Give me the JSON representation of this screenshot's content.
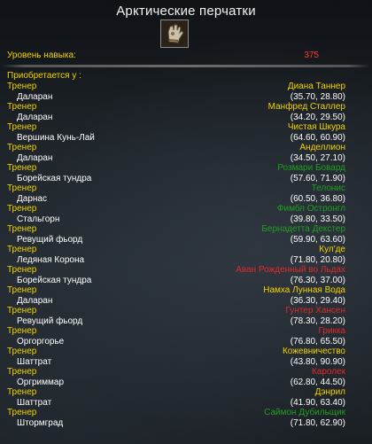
{
  "tooltip": {
    "title": "Арктические перчатки",
    "icon": "gloves-icon",
    "skill_label": "Уровень навыка:",
    "skill_value": "375",
    "acquired_label": "Приобретается у :"
  },
  "colors": {
    "label_yellow": "#f3d400",
    "value_red": "#ff3b30",
    "neutral": "#f3d400",
    "alliance": "#1fa01f",
    "horde": "#e02a2a",
    "white": "#ffffff"
  },
  "entries": [
    {
      "type": "Тренер",
      "npc": "Диана Таннер",
      "zone": "Даларан",
      "coords": "(35.70, 28.80)",
      "color": "#f3d400"
    },
    {
      "type": "Тренер",
      "npc": "Манфред Сталлер",
      "zone": "Даларан",
      "coords": "(34.20, 29.50)",
      "color": "#f3d400"
    },
    {
      "type": "Тренер",
      "npc": "Чистая Шкура",
      "zone": "Вершина Кунь-Лай",
      "coords": "(64.60, 60.90)",
      "color": "#f3d400"
    },
    {
      "type": "Тренер",
      "npc": "Анделлион",
      "zone": "Даларан",
      "coords": "(34.50, 27.10)",
      "color": "#f3d400"
    },
    {
      "type": "Тренер",
      "npc": "Розмари Бовард",
      "zone": "Борейская тундра",
      "coords": "(57.60, 71.90)",
      "color": "#1fa01f"
    },
    {
      "type": "Тренер",
      "npc": "Телонис",
      "zone": "Дарнас",
      "coords": "(60.50, 36.80)",
      "color": "#1fa01f"
    },
    {
      "type": "Тренер",
      "npc": "Фимбл Остронгл",
      "zone": "Стальгорн",
      "coords": "(39.80, 33.50)",
      "color": "#1fa01f"
    },
    {
      "type": "Тренер",
      "npc": "Бернадетта Декстер",
      "zone": "Ревущий фьорд",
      "coords": "(59.90, 63.60)",
      "color": "#1fa01f"
    },
    {
      "type": "Тренер",
      "npc": "Кул'де",
      "zone": "Ледяная Корона",
      "coords": "(71.80, 20.80)",
      "color": "#f3d400"
    },
    {
      "type": "Тренер",
      "npc": "Аван Рожденный во Льдах",
      "zone": "Борейская тундра",
      "coords": "(76.30, 37.00)",
      "color": "#e02a2a"
    },
    {
      "type": "Тренер",
      "npc": "Намха Лунная Вода",
      "zone": "Даларан",
      "coords": "(36.30, 29.40)",
      "color": "#f3d400"
    },
    {
      "type": "Тренер",
      "npc": "Гунтер Хансен",
      "zone": "Ревущий фьорд",
      "coords": "(78.30, 28.20)",
      "color": "#e02a2a"
    },
    {
      "type": "Тренер",
      "npc": "Грикка",
      "zone": "Оргоргорье",
      "coords": "(76.80, 65.50)",
      "color": "#e02a2a"
    },
    {
      "type": "Тренер",
      "npc": "Кожевничество",
      "zone": "Шаттрат",
      "coords": "(43.80, 90.90)",
      "color": "#f3d400"
    },
    {
      "type": "Тренер",
      "npc": "Каролек",
      "zone": "Оргриммар",
      "coords": "(62.80, 44.50)",
      "color": "#e02a2a"
    },
    {
      "type": "Тренер",
      "npc": "Дэнрил",
      "zone": "Шаттрат",
      "coords": "(41.90, 63.40)",
      "color": "#f3d400"
    },
    {
      "type": "Тренер",
      "npc": "Саймон Дубильщик",
      "zone": "Штормград",
      "coords": "(71.80, 62.90)",
      "color": "#1fa01f"
    }
  ]
}
